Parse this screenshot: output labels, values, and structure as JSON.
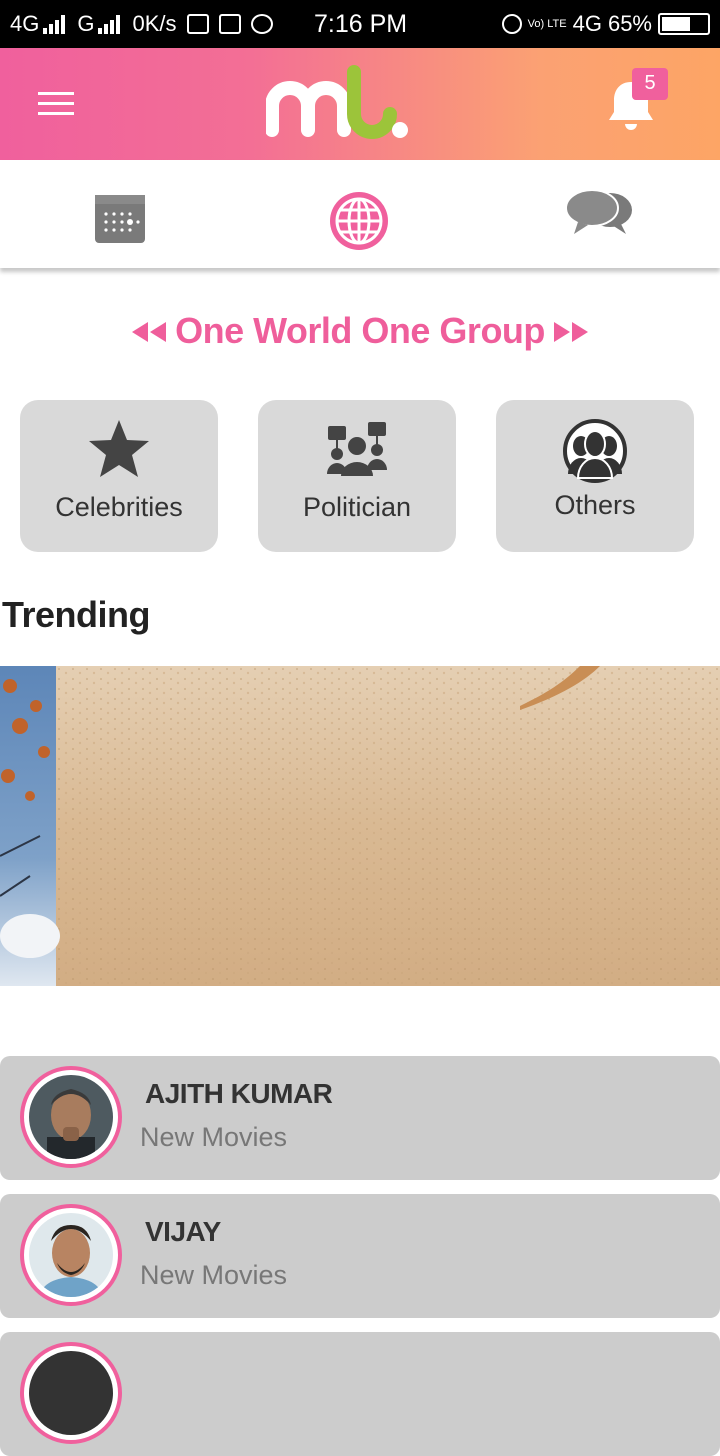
{
  "status_bar": {
    "network1": "4G",
    "network2": "G",
    "speed": "0K/s",
    "time": "7:16 PM",
    "volte": "Vo) LTE",
    "network3": "4G",
    "battery": "65%"
  },
  "app_bar": {
    "notification_count": "5",
    "colors": {
      "gradient_start": "#f0609d",
      "gradient_end": "#fda565",
      "logo_lime": "#9cc43a"
    }
  },
  "tabs": [
    {
      "icon": "calendar-icon",
      "active": false
    },
    {
      "icon": "globe-icon",
      "active": true
    },
    {
      "icon": "chat-icon",
      "active": false
    }
  ],
  "group_nav": {
    "title": "One World One Group",
    "accent": "#ef5e9b"
  },
  "categories": [
    {
      "label": "Celebrities",
      "icon": "star-icon"
    },
    {
      "label": "Politician",
      "icon": "protest-icon"
    },
    {
      "label": "Others",
      "icon": "group-icon"
    }
  ],
  "trending": {
    "heading": "Trending"
  },
  "list": [
    {
      "name": "AJITH KUMAR",
      "subtitle": "New Movies"
    },
    {
      "name": "VIJAY",
      "subtitle": "New Movies"
    }
  ]
}
